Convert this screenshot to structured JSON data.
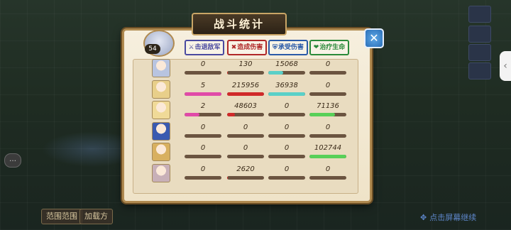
{
  "dialog": {
    "title": "战斗统计",
    "close_label": "✕",
    "leader_level": "54"
  },
  "headers": [
    {
      "icon": "swords-icon",
      "glyph": "⚔",
      "label": "击退敌军",
      "color": "#4a4aa0"
    },
    {
      "icon": "blades-icon",
      "glyph": "✖",
      "label": "造成伤害",
      "color": "#b02828"
    },
    {
      "icon": "shield-icon",
      "glyph": "⛨",
      "label": "承受伤害",
      "color": "#2a5aa8"
    },
    {
      "icon": "heart-icon",
      "glyph": "❤",
      "label": "治疗生命",
      "color": "#2a8a3a"
    }
  ],
  "rows": [
    {
      "portrait_color": "#b8c4e0",
      "kills": "0",
      "kills_frac": 0,
      "damage": "130",
      "damage_frac": 0.005,
      "taken": "15068",
      "taken_frac": 0.4,
      "heal": "0",
      "heal_frac": 0
    },
    {
      "portrait_color": "#e8cf8a",
      "kills": "5",
      "kills_frac": 1.0,
      "damage": "215956",
      "damage_frac": 1.0,
      "taken": "36938",
      "taken_frac": 1.0,
      "heal": "0",
      "heal_frac": 0
    },
    {
      "portrait_color": "#f0da98",
      "kills": "2",
      "kills_frac": 0.4,
      "damage": "48603",
      "damage_frac": 0.22,
      "taken": "0",
      "taken_frac": 0,
      "heal": "71136",
      "heal_frac": 0.69
    },
    {
      "portrait_color": "#3a5ab0",
      "kills": "0",
      "kills_frac": 0,
      "damage": "0",
      "damage_frac": 0,
      "taken": "0",
      "taken_frac": 0,
      "heal": "0",
      "heal_frac": 0
    },
    {
      "portrait_color": "#d8b060",
      "kills": "0",
      "kills_frac": 0,
      "damage": "0",
      "damage_frac": 0,
      "taken": "0",
      "taken_frac": 0,
      "heal": "102744",
      "heal_frac": 1.0
    },
    {
      "portrait_color": "#c8b0b8",
      "kills": "0",
      "kills_frac": 0,
      "damage": "2620",
      "damage_frac": 0.012,
      "taken": "0",
      "taken_frac": 0,
      "heal": "0",
      "heal_frac": 0
    }
  ],
  "bar_colors": {
    "kills": "#e04aa8",
    "damage": "#d02a2a",
    "taken": "#5ad0c8",
    "heal": "#58d058"
  },
  "background": {
    "chat_icon_glyph": "…",
    "tag_1": "范围范围",
    "tag_2": "加载方",
    "continue_text": "点击屏幕继续",
    "continue_glyph": "✥"
  }
}
